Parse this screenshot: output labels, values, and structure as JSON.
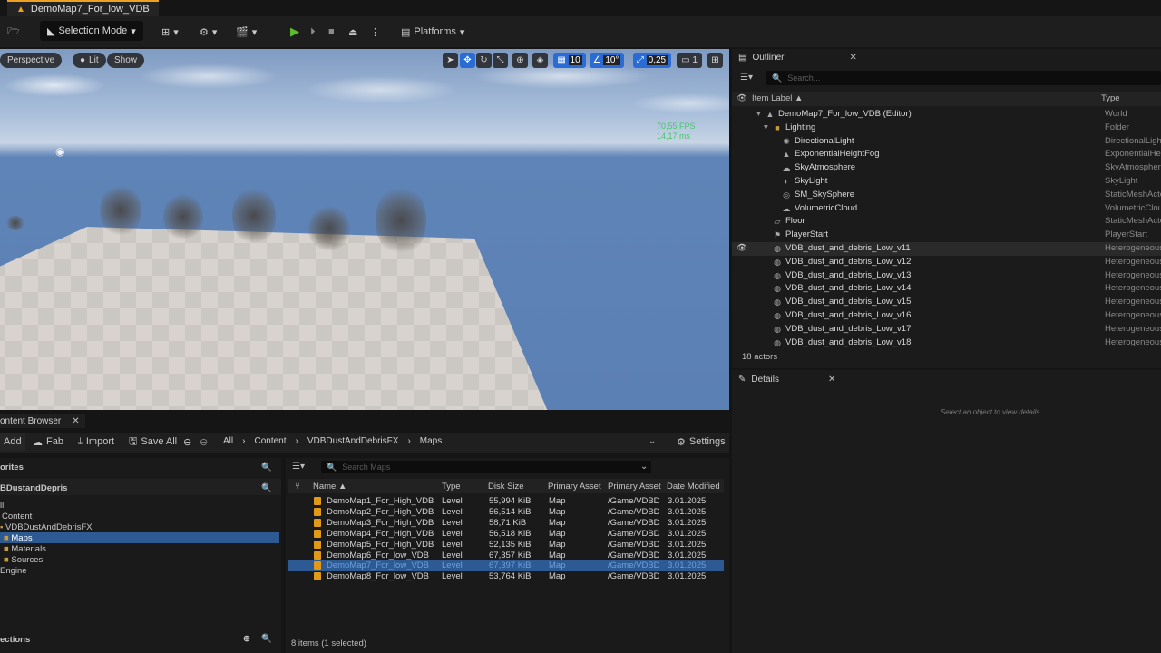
{
  "title_bar": {
    "tab_label": "DemoMap7_For_low_VDB"
  },
  "toolbar": {
    "selection_mode": "Selection Mode",
    "platforms": "Platforms"
  },
  "viewport": {
    "perspective": "Perspective",
    "lit": "Lit",
    "show": "Show",
    "grid_snap": "10",
    "angle_snap": "10°",
    "scale_snap": "0,25",
    "camera_speed": "1",
    "fps": "70,55 FPS",
    "frame_ms": "14,17 ms"
  },
  "outliner": {
    "tab_label": "Outliner",
    "search_placeholder": "Search...",
    "col_label": "Item Label ▲",
    "col_type": "Type",
    "rows": [
      {
        "label": "DemoMap7_For_low_VDB (Editor)",
        "type": "World"
      },
      {
        "label": "Lighting",
        "type": "Folder"
      },
      {
        "label": "DirectionalLight",
        "type": "DirectionalLight"
      },
      {
        "label": "ExponentialHeightFog",
        "type": "ExponentialHeightFog"
      },
      {
        "label": "SkyAtmosphere",
        "type": "SkyAtmosphere"
      },
      {
        "label": "SkyLight",
        "type": "SkyLight"
      },
      {
        "label": "SM_SkySphere",
        "type": "StaticMeshActor"
      },
      {
        "label": "VolumetricCloud",
        "type": "VolumetricCloud"
      },
      {
        "label": "Floor",
        "type": "StaticMeshActor"
      },
      {
        "label": "PlayerStart",
        "type": "PlayerStart"
      },
      {
        "label": "VDB_dust_and_debris_Low_v11",
        "type": "HeterogeneousVolume"
      },
      {
        "label": "VDB_dust_and_debris_Low_v12",
        "type": "HeterogeneousVolume"
      },
      {
        "label": "VDB_dust_and_debris_Low_v13",
        "type": "HeterogeneousVolume"
      },
      {
        "label": "VDB_dust_and_debris_Low_v14",
        "type": "HeterogeneousVolume"
      },
      {
        "label": "VDB_dust_and_debris_Low_v15",
        "type": "HeterogeneousVolume"
      },
      {
        "label": "VDB_dust_and_debris_Low_v16",
        "type": "HeterogeneousVolume"
      },
      {
        "label": "VDB_dust_and_debris_Low_v17",
        "type": "HeterogeneousVolume"
      },
      {
        "label": "VDB_dust_and_debris_Low_v18",
        "type": "HeterogeneousVolume"
      }
    ],
    "actors_count": "18 actors"
  },
  "details": {
    "tab_label": "Details",
    "empty_message": "Select an object to view details."
  },
  "content_browser": {
    "tab_label": "ontent Browser",
    "add": "Add",
    "fab": "Fab",
    "import": "Import",
    "save_all": "Save All",
    "settings": "Settings",
    "breadcrumb": [
      "All",
      "Content",
      "VDBDustAndDebrisFX",
      "Maps"
    ],
    "favorites": "orites",
    "root": "BDustandDepris",
    "tree": [
      "ll",
      "Content",
      "VDBDustAndDebrisFX",
      "Maps",
      "Materials",
      "Sources",
      "Engine"
    ],
    "collections": "ections",
    "search_placeholder": "Search Maps",
    "columns": [
      "Name ▲",
      "Type",
      "Disk Size",
      "Primary Asset",
      "Primary Asset",
      "Date Modified"
    ],
    "files": [
      {
        "name": "DemoMap1_For_High_VDB",
        "type": "Level",
        "size": "55,994 KiB",
        "asset": "Map",
        "path": "/Game/VDBD",
        "date": "3.01.2025"
      },
      {
        "name": "DemoMap2_For_High_VDB",
        "type": "Level",
        "size": "56,514 KiB",
        "asset": "Map",
        "path": "/Game/VDBD",
        "date": "3.01.2025"
      },
      {
        "name": "DemoMap3_For_High_VDB",
        "type": "Level",
        "size": "58,71 KiB",
        "asset": "Map",
        "path": "/Game/VDBD",
        "date": "3.01.2025"
      },
      {
        "name": "DemoMap4_For_High_VDB",
        "type": "Level",
        "size": "56,518 KiB",
        "asset": "Map",
        "path": "/Game/VDBD",
        "date": "3.01.2025"
      },
      {
        "name": "DemoMap5_For_High_VDB",
        "type": "Level",
        "size": "52,135 KiB",
        "asset": "Map",
        "path": "/Game/VDBD",
        "date": "3.01.2025"
      },
      {
        "name": "DemoMap6_For_low_VDB",
        "type": "Level",
        "size": "67,357 KiB",
        "asset": "Map",
        "path": "/Game/VDBD",
        "date": "3.01.2025"
      },
      {
        "name": "DemoMap7_For_low_VDB",
        "type": "Level",
        "size": "67,397 KiB",
        "asset": "Map",
        "path": "/Game/VDBD",
        "date": "3.01.2025"
      },
      {
        "name": "DemoMap8_For_low_VDB",
        "type": "Level",
        "size": "53,764 KiB",
        "asset": "Map",
        "path": "/Game/VDBD",
        "date": "3.01.2025"
      }
    ],
    "status": "8 items (1 selected)"
  }
}
